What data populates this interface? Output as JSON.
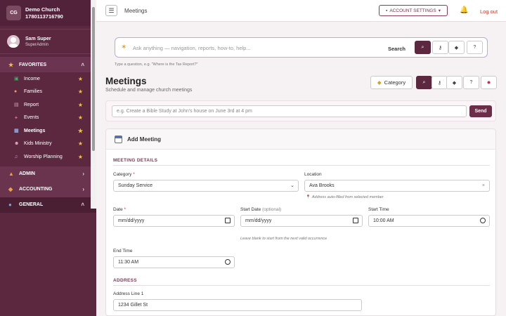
{
  "sidebar": {
    "logo": "CG",
    "church_name": "Demo Church",
    "church_id": "1780113716790",
    "user_name": "Sam Super",
    "user_role": "SuperAdmin",
    "favorites_label": "FAVORITES",
    "items": [
      {
        "label": "Income",
        "icon": "income-icon"
      },
      {
        "label": "Families",
        "icon": "families-icon"
      },
      {
        "label": "Report",
        "icon": "report-icon"
      },
      {
        "label": "Events",
        "icon": "events-icon"
      },
      {
        "label": "Meetings",
        "icon": "meetings-icon"
      },
      {
        "label": "Kids Ministry",
        "icon": "kids-icon"
      },
      {
        "label": "Worship Planning",
        "icon": "music-icon"
      }
    ],
    "admin_label": "ADMIN",
    "accounting_label": "ACCOUNTING",
    "general_label": "GENERAL"
  },
  "topbar": {
    "breadcrumb": "Meetings",
    "account_settings": "ACCOUNT SETTINGS",
    "logout": "Log out"
  },
  "ask": {
    "placeholder": "Ask anything — navigation, reports, how-to, help...",
    "search_label": "Search",
    "hint": "Type a question, e.g. \"Where is the Tax Report?\""
  },
  "page": {
    "title": "Meetings",
    "subtitle": "Schedule and manage church meetings",
    "category_button": "Category"
  },
  "command": {
    "placeholder": "e.g. Create a Bible Study at John's house on June 3rd at 4 pm",
    "send": "Send"
  },
  "form": {
    "card_title": "Add Meeting",
    "meeting_details_header": "MEETING DETAILS",
    "category_label": "Category",
    "category_value": "Sunday Service",
    "location_label": "Location",
    "location_value": "Ava Brooks",
    "location_note": "Address auto-filled from selected member",
    "date_label": "Date",
    "date_value": "mm/dd/yyyy",
    "start_date_label": "Start Date",
    "start_date_optional": "(optional)",
    "start_date_value": "mm/dd/yyyy",
    "start_date_note": "Leave blank to start from the next valid occurrence",
    "start_time_label": "Start Time",
    "start_time_value": "10:00 AM",
    "end_time_label": "End Time",
    "end_time_value": "11:30 AM",
    "address_header": "ADDRESS",
    "address1_label": "Address Line 1",
    "address1_value": "1234 Gillet St"
  },
  "colors": {
    "sidebar_bg": "#5b2840",
    "accent": "#6b2d47",
    "star": "#f0c23b"
  }
}
